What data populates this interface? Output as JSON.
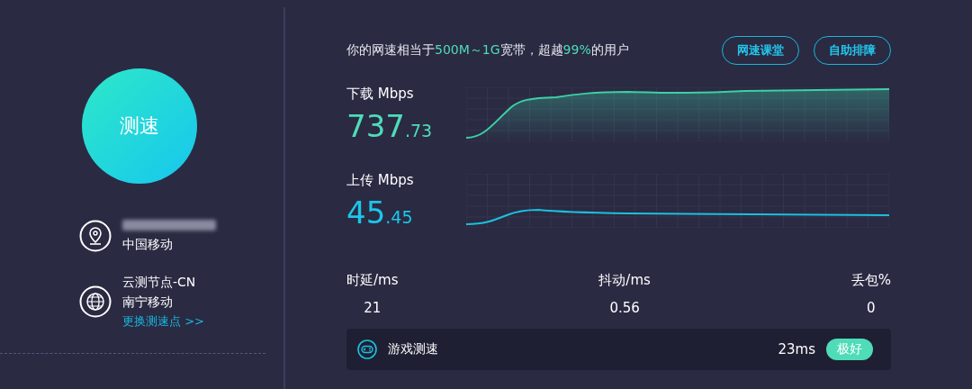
{
  "start_button": {
    "label": "测速"
  },
  "location": {
    "isp": "中国移动"
  },
  "node": {
    "name": "云测节点-CN",
    "isp": "南宁移动",
    "change_link": "更换测速点 >>"
  },
  "headline": [
    {
      "text": "你的网速相当于",
      "highlight": false
    },
    {
      "text": "500M～1G",
      "highlight": true
    },
    {
      "text": "宽带，超越",
      "highlight": false
    },
    {
      "text": "99%",
      "highlight": true
    },
    {
      "text": "的用户",
      "highlight": false
    }
  ],
  "buttons": [
    "网速课堂",
    "自助排障"
  ],
  "speeds": [
    {
      "kind": "download",
      "label": "下载 Mbps",
      "integer": "737",
      "decimal": ".73"
    },
    {
      "kind": "upload",
      "label": "上传 Mbps",
      "integer": "45",
      "decimal": ".45"
    }
  ],
  "stats": [
    {
      "label": "时延/ms",
      "value": "21"
    },
    {
      "label": "抖动/ms",
      "value": "0.56"
    },
    {
      "label": "丢包%",
      "value": "0"
    }
  ],
  "game": {
    "label": "游戏测速",
    "latency": "23ms",
    "rating": "极好"
  }
}
